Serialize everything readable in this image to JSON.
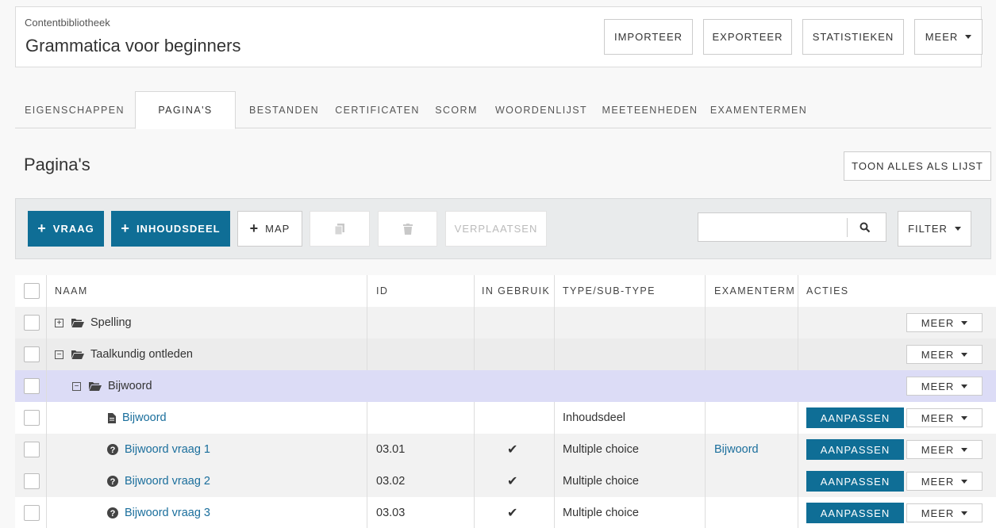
{
  "header": {
    "subtitle": "Contentbibliotheek",
    "title": "Grammatica voor beginners",
    "buttons": {
      "import": "IMPORTEER",
      "export": "EXPORTEER",
      "stats": "STATISTIEKEN",
      "more": "MEER"
    }
  },
  "tabs": [
    "EIGENSCHAPPEN",
    "PAGINA'S",
    "BESTANDEN",
    "CERTIFICATEN",
    "SCORM",
    "WOORDENLIJST",
    "MEETEENHEDEN",
    "EXAMENTERMEN"
  ],
  "active_tab": "PAGINA'S",
  "section": {
    "title": "Pagina's",
    "show_all": "TOON ALLES ALS LIJST"
  },
  "toolbar": {
    "question": "VRAAG",
    "content_part": "INHOUDSDEEL",
    "folder": "MAP",
    "move": "VERPLAATSEN",
    "search_placeholder": "",
    "filter": "FILTER"
  },
  "table": {
    "columns": {
      "name": "NAAM",
      "id": "ID",
      "in_use": "IN GEBRUIK",
      "type": "TYPE/SUB-TYPE",
      "exam_term": "EXAMENTERM",
      "actions": "ACTIES"
    },
    "more_label": "MEER",
    "edit_label": "AANPASSEN",
    "check_mark": "✔",
    "rows": [
      {
        "name": "Spelling",
        "id": "",
        "type": "",
        "exam_term": ""
      },
      {
        "name": "Taalkundig ontleden",
        "id": "",
        "type": "",
        "exam_term": ""
      },
      {
        "name": "Bijwoord",
        "id": "",
        "type": "",
        "exam_term": ""
      },
      {
        "name": "Bijwoord",
        "id": "",
        "type": "Inhoudsdeel",
        "exam_term": ""
      },
      {
        "name": "Bijwoord vraag 1",
        "id": "03.01",
        "type": "Multiple choice",
        "exam_term": "Bijwoord"
      },
      {
        "name": "Bijwoord vraag 2",
        "id": "03.02",
        "type": "Multiple choice",
        "exam_term": ""
      },
      {
        "name": "Bijwoord vraag 3",
        "id": "03.03",
        "type": "Multiple choice",
        "exam_term": ""
      }
    ]
  },
  "colors": {
    "primary": "#0f6e96",
    "link": "#1a6e9c",
    "selected_row": "#dcdcf6"
  }
}
